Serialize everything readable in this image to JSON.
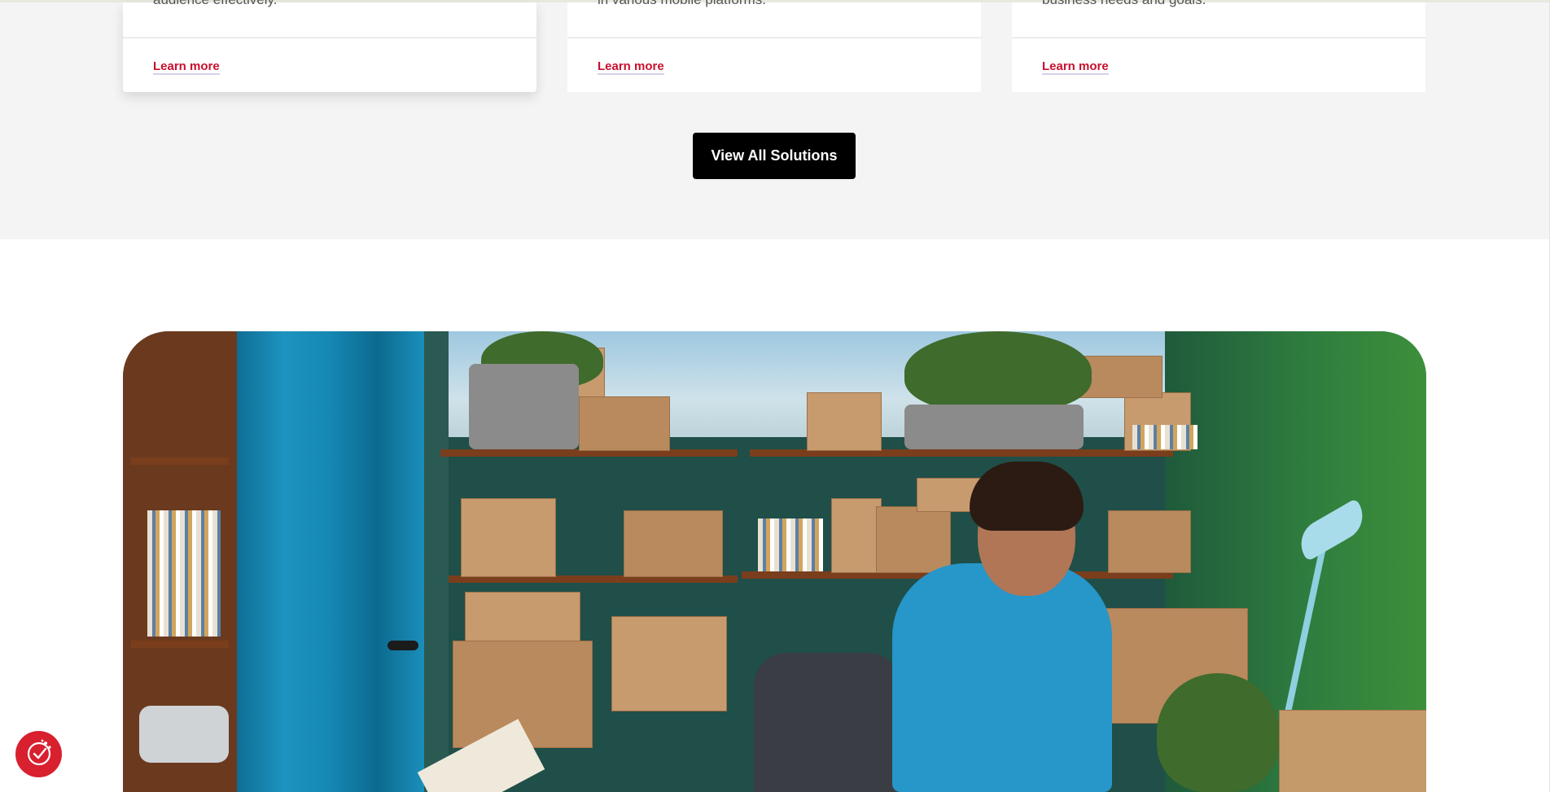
{
  "solutions": {
    "cards": [
      {
        "description": "audience effectively.",
        "link_label": "Learn more"
      },
      {
        "description": "in various mobile platforms.",
        "link_label": "Learn more"
      },
      {
        "description": "business needs and goals.",
        "link_label": "Learn more"
      }
    ],
    "view_all_label": "View All Solutions"
  },
  "hero": {
    "image_icon": "photo-man-working-among-boxes"
  },
  "consent": {
    "icon": "cookie-check-icon"
  },
  "colors": {
    "link_red": "#c8102e",
    "button_black": "#000000",
    "section_bg": "#f4f4f4",
    "consent_red": "#d8202f"
  }
}
